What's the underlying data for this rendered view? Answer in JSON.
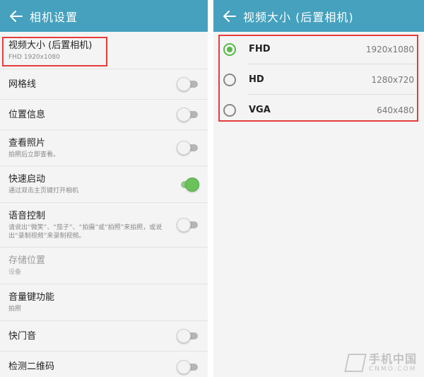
{
  "left": {
    "title": "相机设置",
    "items": [
      {
        "title": "视频大小 (后置相机)",
        "sub": "FHD 1920x1080",
        "control": "none"
      },
      {
        "title": "网格线",
        "sub": "",
        "control": "toggle",
        "on": false
      },
      {
        "title": "位置信息",
        "sub": "",
        "control": "toggle",
        "on": false
      },
      {
        "title": "查看照片",
        "sub": "拍照后立即查看。",
        "control": "toggle",
        "on": false
      },
      {
        "title": "快速启动",
        "sub": "通过双击主页键打开相机",
        "control": "toggle",
        "on": true
      },
      {
        "title": "语音控制",
        "sub": "请说出“微笑”、“茄子”、“拍摄”或“拍照”来拍照，或说出“录制视频”来录制视频。",
        "control": "toggle",
        "on": false
      },
      {
        "title": "存储位置",
        "sub": "设备",
        "control": "none",
        "disabled": true
      },
      {
        "title": "音量键功能",
        "sub": "拍照",
        "control": "none"
      },
      {
        "title": "快门音",
        "sub": "",
        "control": "toggle",
        "on": false
      },
      {
        "title": "检测二维码",
        "sub": "",
        "control": "toggle",
        "on": false
      }
    ]
  },
  "right": {
    "title": "视频大小 (后置相机)",
    "options": [
      {
        "label": "FHD",
        "value": "1920x1080",
        "selected": true
      },
      {
        "label": "HD",
        "value": "1280x720",
        "selected": false
      },
      {
        "label": "VGA",
        "value": "640x480",
        "selected": false
      }
    ]
  },
  "watermark": {
    "cn": "手机中国",
    "en": "CNMO.COM"
  },
  "colors": {
    "appbar": "#45a1be",
    "toggle_on": "#6bc15a",
    "highlight": "#e53c3c"
  }
}
